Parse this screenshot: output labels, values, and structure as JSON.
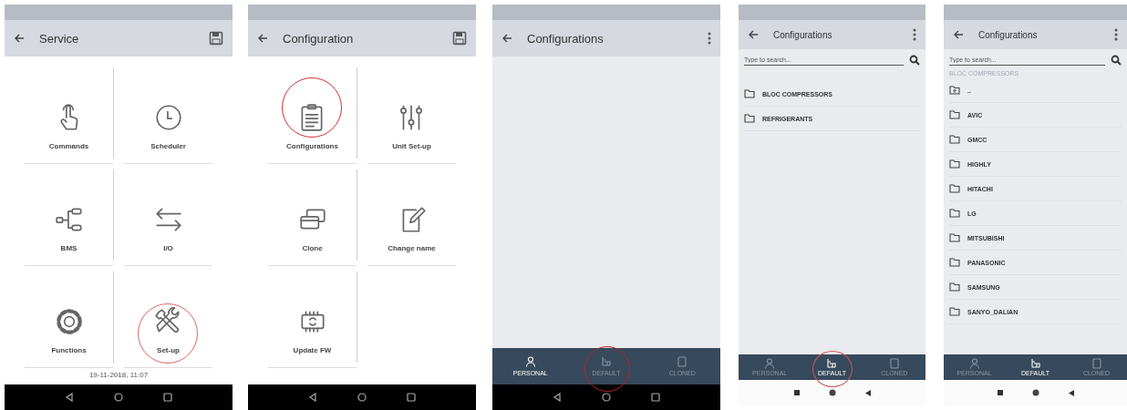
{
  "screens": [
    {
      "kind": "grid",
      "title": "Service",
      "action": {
        "kind": "save"
      },
      "nav_bar": {
        "kind": "dark"
      },
      "footer": "19-11-2018, 11:07",
      "tiles": [
        {
          "label": "Commands",
          "kind": "hand",
          "circled": false
        },
        {
          "label": "Scheduler",
          "kind": "clock",
          "circled": false
        },
        {
          "label": "BMS",
          "kind": "tree",
          "circled": false
        },
        {
          "label": "I/O",
          "kind": "arrows",
          "circled": false
        },
        {
          "label": "Functions",
          "kind": "gear",
          "circled": false
        },
        {
          "label": "Set-up",
          "kind": "tools",
          "circled": true
        }
      ]
    },
    {
      "kind": "grid",
      "title": "Configuration",
      "action": {
        "kind": "save"
      },
      "nav_bar": {
        "kind": "dark"
      },
      "tiles": [
        {
          "label": "Configurations",
          "kind": "clipboard",
          "circled": true
        },
        {
          "label": "Unit Set-up",
          "kind": "sliders",
          "circled": false
        },
        {
          "label": "Clone",
          "kind": "windows",
          "circled": false
        },
        {
          "label": "Change name",
          "kind": "edit",
          "circled": false
        },
        {
          "label": "Update FW",
          "kind": "chip",
          "circled": false
        }
      ]
    },
    {
      "kind": "list",
      "title": "Configurations",
      "action": {
        "kind": "menu"
      },
      "nav_bar": {
        "kind": "dark"
      },
      "tabs": [
        {
          "label": "PERSONAL",
          "kind": "person",
          "selected": true,
          "circled": false
        },
        {
          "label": "DEFAULT",
          "kind": "tree",
          "selected": false,
          "circled": true
        },
        {
          "label": "CLONED",
          "kind": "doc",
          "selected": false,
          "circled": false
        }
      ]
    },
    {
      "kind": "list",
      "title": "Configurations",
      "action": {
        "kind": "menu"
      },
      "nav_bar": {
        "kind": "light"
      },
      "search": {
        "placeholder": "Type to search..."
      },
      "items": [
        {
          "label": "BLOC COMPRESSORS",
          "kind": "folder"
        },
        {
          "label": "REFRIGERANTS",
          "kind": "folder"
        }
      ],
      "tabs": [
        {
          "label": "PERSONAL",
          "kind": "person",
          "selected": false,
          "circled": false
        },
        {
          "label": "DEFAULT",
          "kind": "tree",
          "selected": true,
          "circled": true
        },
        {
          "label": "CLONED",
          "kind": "doc",
          "selected": false,
          "circled": false
        }
      ]
    },
    {
      "kind": "list",
      "title": "Configurations",
      "action": {
        "kind": "menu"
      },
      "nav_bar": {
        "kind": "light"
      },
      "search": {
        "placeholder": "Type to search..."
      },
      "path": "BLOC COMPRESSORS",
      "items": [
        {
          "label": "..",
          "kind": "up"
        },
        {
          "label": "AVIC",
          "kind": "folder"
        },
        {
          "label": "GMCC",
          "kind": "folder"
        },
        {
          "label": "HIGHLY",
          "kind": "folder"
        },
        {
          "label": "HITACHI",
          "kind": "folder"
        },
        {
          "label": "LG",
          "kind": "folder"
        },
        {
          "label": "MITSUBISHI",
          "kind": "folder"
        },
        {
          "label": "PANASONIC",
          "kind": "folder"
        },
        {
          "label": "SAMSUNG",
          "kind": "folder"
        },
        {
          "label": "SANYO_DALIAN",
          "kind": "folder"
        }
      ],
      "tabs": [
        {
          "label": "PERSONAL",
          "kind": "person",
          "selected": false,
          "circled": false
        },
        {
          "label": "DEFAULT",
          "kind": "tree",
          "selected": true,
          "circled": false
        },
        {
          "label": "CLONED",
          "kind": "doc",
          "selected": false,
          "circled": false
        }
      ]
    }
  ]
}
